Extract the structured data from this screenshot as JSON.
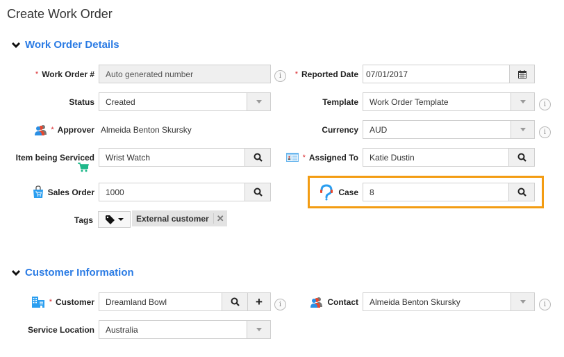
{
  "page": {
    "title": "Create Work Order"
  },
  "colors": {
    "accent": "#2a7be4",
    "required": "#d9262a",
    "highlight": "#f39c12"
  },
  "sections": {
    "details": {
      "title": "Work Order Details",
      "work_order_no": {
        "label": "Work Order #",
        "placeholder": "Auto generated number",
        "required": true
      },
      "reported_date": {
        "label": "Reported Date",
        "value": "07/01/2017",
        "icon": "calendar-icon",
        "required": true
      },
      "status": {
        "label": "Status",
        "value": "Created"
      },
      "template": {
        "label": "Template",
        "value": "Work Order Template"
      },
      "approver": {
        "label": "Approver",
        "value": "Almeida Benton Skursky",
        "icon": "users-icon",
        "required": true
      },
      "currency": {
        "label": "Currency",
        "value": "AUD"
      },
      "item_serviced": {
        "label": "Item being Serviced",
        "value": "Wrist Watch",
        "icon": "cart-icon"
      },
      "assigned_to": {
        "label": "Assigned To",
        "value": "Katie Dustin",
        "icon": "contact-card-icon",
        "required": true
      },
      "sales_order": {
        "label": "Sales Order",
        "value": "1000",
        "icon": "shopping-bag-icon"
      },
      "case": {
        "label": "Case",
        "value": "8",
        "icon": "support-icon"
      },
      "tags": {
        "label": "Tags",
        "items": [
          "External customer"
        ]
      }
    },
    "customer": {
      "title": "Customer Information",
      "customer": {
        "label": "Customer",
        "value": "Dreamland Bowl",
        "icon": "building-icon",
        "required": true
      },
      "contact": {
        "label": "Contact",
        "value": "Almeida Benton Skursky",
        "icon": "users-icon"
      },
      "service_location": {
        "label": "Service Location",
        "value": "Australia"
      }
    }
  },
  "glyphs": {
    "required": "*",
    "info": "i",
    "plus": "+",
    "remove": "✕"
  }
}
